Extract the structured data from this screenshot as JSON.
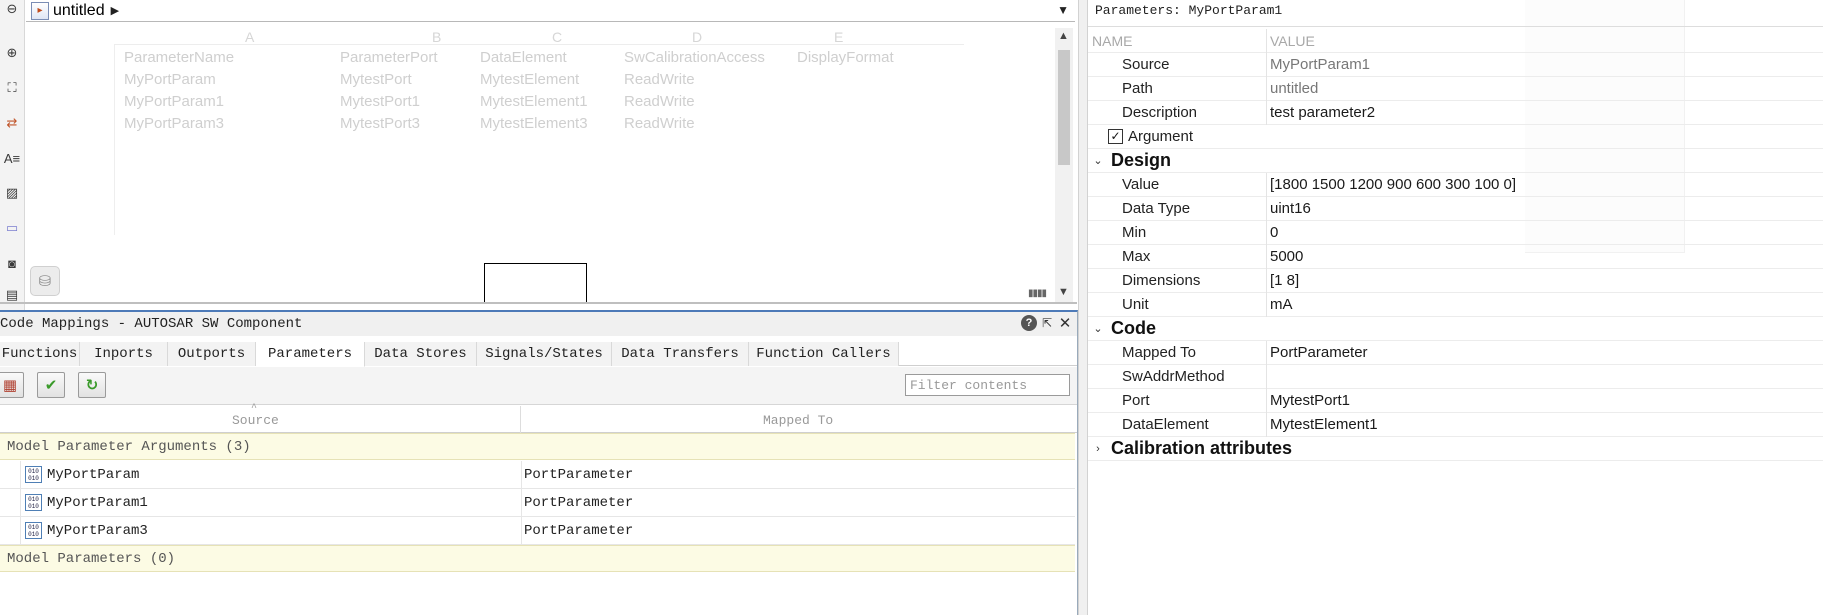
{
  "canvas": {
    "model_name": "untitled",
    "ghost_table": {
      "columns": [
        "A",
        "B",
        "C",
        "D",
        "E"
      ],
      "rows": [
        [
          "ParameterName",
          "ParameterPort",
          "DataElement",
          "SwCalibrationAccess",
          "DisplayFormat"
        ],
        [
          "MyPortParam",
          "MytestPort",
          "MytestElement",
          "ReadWrite",
          ""
        ],
        [
          "MyPortParam1",
          "MytestPort1",
          "MytestElement1",
          "ReadWrite",
          ""
        ],
        [
          "MyPortParam3",
          "MytestPort3",
          "MytestElement3",
          "ReadWrite",
          ""
        ]
      ]
    }
  },
  "code_mappings": {
    "title": "Code Mappings - AUTOSAR SW Component",
    "tabs": [
      {
        "label": "Functions",
        "active": false
      },
      {
        "label": "Inports",
        "active": false
      },
      {
        "label": "Outports",
        "active": false
      },
      {
        "label": "Parameters",
        "active": true
      },
      {
        "label": "Data Stores",
        "active": false
      },
      {
        "label": "Signals/States",
        "active": false
      },
      {
        "label": "Data Transfers",
        "active": false
      },
      {
        "label": "Function Callers",
        "active": false
      }
    ],
    "filter_placeholder": "Filter contents",
    "columns": {
      "source": "Source",
      "mapped_to": "Mapped To"
    },
    "groups": [
      {
        "label": "Model Parameter Arguments (3)",
        "rows": [
          {
            "source": "MyPortParam",
            "mapped_to": "PortParameter"
          },
          {
            "source": "MyPortParam1",
            "mapped_to": "PortParameter"
          },
          {
            "source": "MyPortParam3",
            "mapped_to": "PortParameter"
          }
        ]
      },
      {
        "label": "Model Parameters (0)",
        "rows": []
      }
    ]
  },
  "property_inspector": {
    "title": "Parameters: MyPortParam1",
    "header": {
      "name": "NAME",
      "value": "VALUE"
    },
    "general": [
      {
        "key": "Source",
        "value": "MyPortParam1",
        "muted": true
      },
      {
        "key": "Path",
        "value": "untitled",
        "muted": true
      },
      {
        "key": "Description",
        "value": "test parameter2",
        "muted": false
      }
    ],
    "argument": {
      "label": "Argument",
      "checked": true,
      "check_glyph": "✓"
    },
    "sections": {
      "design": "Design",
      "code": "Code",
      "calibration": "Calibration attributes"
    },
    "design": [
      {
        "key": "Value",
        "value": "[1800 1500 1200 900 600 300 100 0]"
      },
      {
        "key": "Data Type",
        "value": "uint16"
      },
      {
        "key": "Min",
        "value": "0"
      },
      {
        "key": "Max",
        "value": "5000"
      },
      {
        "key": "Dimensions",
        "value": "[1 8]"
      },
      {
        "key": "Unit",
        "value": "mA"
      }
    ],
    "code": [
      {
        "key": "Mapped To",
        "value": "PortParameter"
      },
      {
        "key": "SwAddrMethod",
        "value": ""
      },
      {
        "key": "Port",
        "value": "MytestPort1"
      },
      {
        "key": "DataElement",
        "value": "MytestElement1"
      }
    ]
  },
  "colors": {
    "group_row_bg": "#fcfbe4",
    "panel_accent": "#4d7ab8",
    "apply_green": "#3a9a2a"
  }
}
